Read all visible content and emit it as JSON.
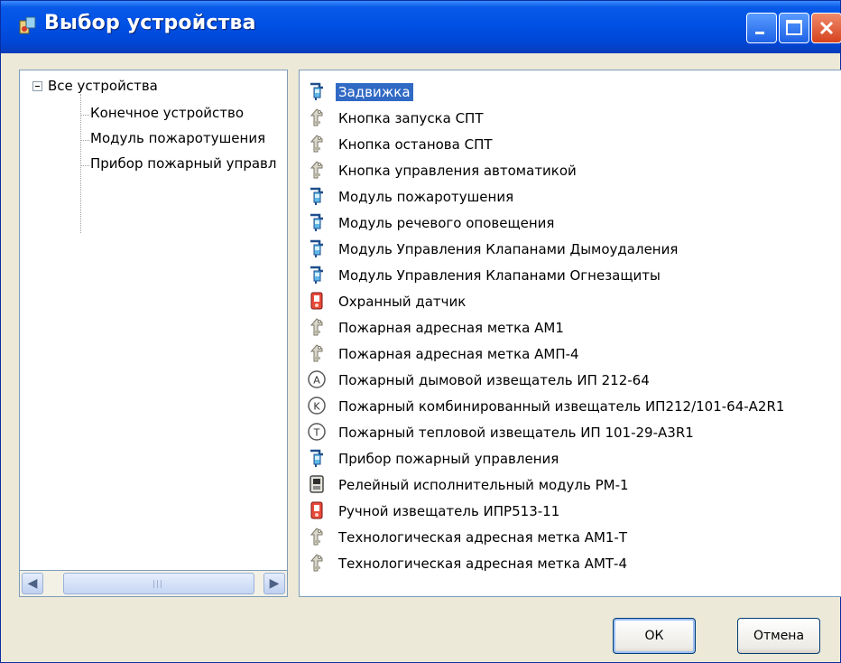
{
  "window": {
    "title": "Выбор устройства",
    "icon": "app-icon"
  },
  "tree": {
    "root": "Все устройства",
    "children": [
      "Конечное устройство",
      "Модуль пожаротушения",
      "Прибор пожарный управл"
    ]
  },
  "devices": [
    {
      "label": "Задвижка",
      "icon": "valve-icon",
      "selected": true
    },
    {
      "label": "Кнопка запуска СПТ",
      "icon": "address-tag-icon"
    },
    {
      "label": "Кнопка останова СПТ",
      "icon": "address-tag-icon"
    },
    {
      "label": "Кнопка управления автоматикой",
      "icon": "address-tag-icon"
    },
    {
      "label": "Модуль пожаротушения",
      "icon": "valve-icon"
    },
    {
      "label": "Модуль речевого оповещения",
      "icon": "valve-icon"
    },
    {
      "label": "Модуль Управления Клапанами Дымоудаления",
      "icon": "valve-icon"
    },
    {
      "label": "Модуль Управления Клапанами Огнезащиты",
      "icon": "valve-icon"
    },
    {
      "label": "Охранный датчик",
      "icon": "red-sensor-icon"
    },
    {
      "label": "Пожарная адресная метка АМ1",
      "icon": "address-tag-icon"
    },
    {
      "label": "Пожарная адресная метка АМП-4",
      "icon": "address-tag-icon"
    },
    {
      "label": "Пожарный дымовой извещатель ИП 212-64",
      "icon": "circle-a-icon",
      "glyph": "A"
    },
    {
      "label": "Пожарный комбинированный извещатель ИП212/101-64-A2R1",
      "icon": "circle-k-icon",
      "glyph": "K"
    },
    {
      "label": "Пожарный тепловой извещатель ИП 101-29-A3R1",
      "icon": "circle-t-icon",
      "glyph": "T"
    },
    {
      "label": "Прибор пожарный управления",
      "icon": "valve-icon"
    },
    {
      "label": "Релейный исполнительный модуль РМ-1",
      "icon": "relay-module-icon"
    },
    {
      "label": "Ручной извещатель ИПР513-11",
      "icon": "red-sensor-icon"
    },
    {
      "label": "Технологическая адресная метка АМ1-Т",
      "icon": "address-tag-icon"
    },
    {
      "label": "Технологическая адресная метка АМТ-4",
      "icon": "address-tag-icon"
    }
  ],
  "buttons": {
    "ok": "ОК",
    "cancel": "Отмена"
  },
  "colors": {
    "titlebar": "#0051e5",
    "selection": "#316ac5",
    "dialog_bg": "#ece9d8"
  }
}
